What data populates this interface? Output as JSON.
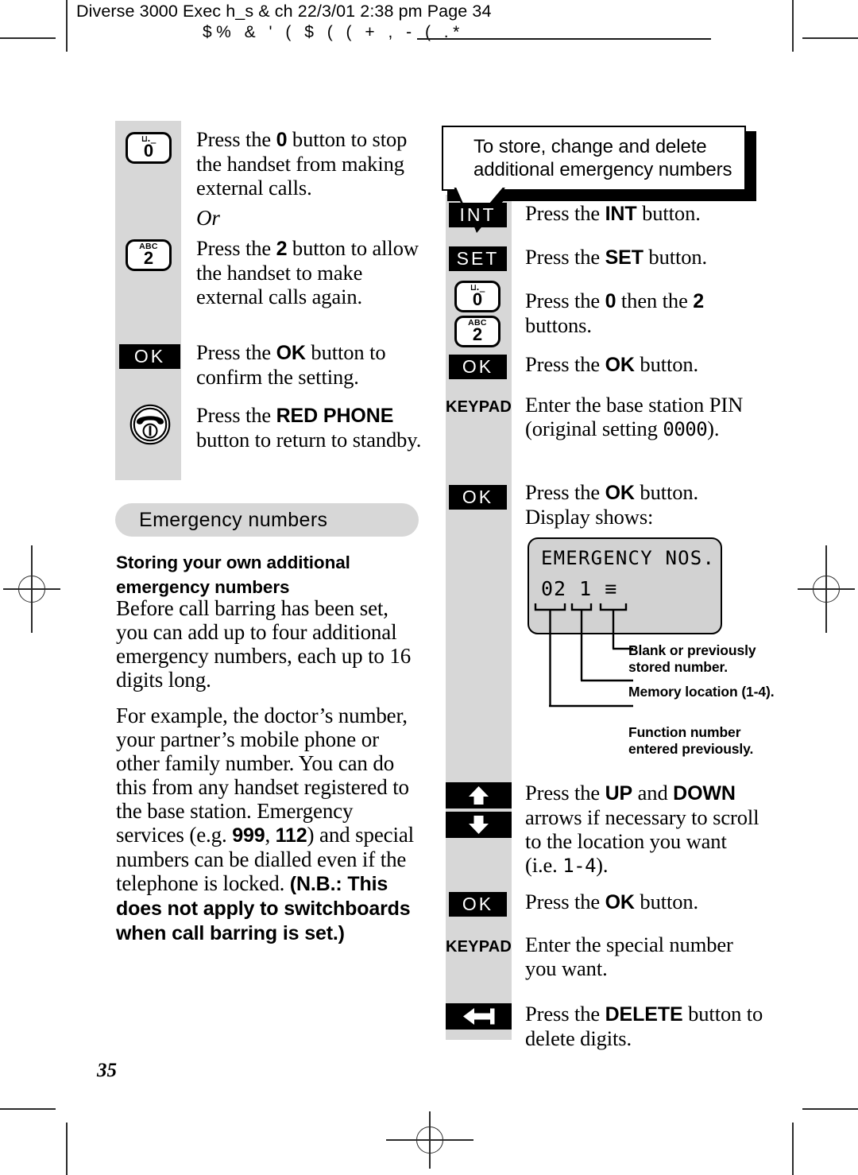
{
  "header": {
    "slug": "Diverse 3000 Exec h_s & ch  22/3/01  2:38 pm  Page 34",
    "slug_symbols": "$%     &   '      ( $      ( ( + ,  -  ( .*"
  },
  "page_number": "35",
  "left_column": {
    "steps": [
      {
        "icon": "key-0",
        "key_sub": "⊔._",
        "key_num": "0",
        "text_html": "Press the <b>0</b> button to stop the handset from making external calls."
      },
      {
        "icon": "none",
        "text_html": "Or",
        "italic": true
      },
      {
        "icon": "key-2",
        "key_sub": "ABC",
        "key_num": "2",
        "text_html": "Press the <b>2</b> button to allow the handset to make external calls again."
      },
      {
        "icon": "chip-ok",
        "chip_label": "OK",
        "text_html": "Press the <b>OK</b> button to confirm the setting."
      },
      {
        "icon": "red-phone",
        "text_html": "Press the <b>RED PHONE</b> button to return to standby."
      }
    ],
    "section_heading": "Emergency numbers",
    "subheading": "Storing your own additional emergency numbers",
    "paragraph_1": "Before call barring has been set, you can add up to four additional emergency numbers, each up to 16 digits long.",
    "paragraph_2_parts": {
      "a": "For example, the doctor’s number, your partner’s mobile phone or other family number. You can do this from any handset registered to the base station. Emergency services (e.g. ",
      "b1": "999",
      "mid": ", ",
      "b2": "112",
      "c": ") and special numbers can be dialled even if the telephone is locked. ",
      "bold_note": "(N.B.: This does not apply to switchboards when call barring is set.)"
    }
  },
  "right_column": {
    "callout": "To store, change and delete additional emergency numbers",
    "steps": [
      {
        "icon": "chip-int",
        "chip_label": "INT",
        "text_html": "Press the <b>INT</b> button."
      },
      {
        "icon": "chip-set",
        "chip_label": "SET",
        "text_html": "Press the <b>SET</b> button."
      },
      {
        "icon": "key-0-then-2",
        "key_sub_a": "⊔._",
        "key_num_a": "0",
        "key_sub_b": "ABC",
        "key_num_b": "2",
        "text_html": "Press the <b>0</b> then the <b>2</b> buttons."
      },
      {
        "icon": "chip-ok",
        "chip_label": "OK",
        "text_html": "Press the <b>OK</b> button."
      },
      {
        "icon": "keypad",
        "chip_label": "KEYPAD",
        "text_html": "Enter the base station PIN (original setting <span class=\"lcdfont\">0000</span>)."
      },
      {
        "icon": "chip-ok",
        "chip_label": "OK",
        "text_html": "Press the <b>OK</b> button. Display shows:"
      },
      {
        "icon": "arrows-updown",
        "text_html": "Press the <b>UP</b> and <b>DOWN</b> arrows if necessary to scroll to the location you want (i.e. <span class=\"lcdfont\">1-4</span>)."
      },
      {
        "icon": "chip-ok",
        "chip_label": "OK",
        "text_html": "Press the <b>OK</b> button."
      },
      {
        "icon": "keypad",
        "chip_label": "KEYPAD",
        "text_html": "Enter the special number you want."
      },
      {
        "icon": "arrow-delete",
        "text_html": "Press the <b>DELETE</b> button to delete digits."
      }
    ],
    "display": {
      "line1": "EMERGENCY NOS.",
      "line2_function": "02",
      "line2_memory": "1",
      "line2_blank": "≡"
    },
    "annotations": [
      "Blank or previously stored number.",
      "Memory location (1-4).",
      "Function number entered previously."
    ]
  },
  "colors": {
    "gutter_gray": "#d7d7d7",
    "lcd_gray": "#d2d2d2",
    "chip_black": "#000000"
  }
}
